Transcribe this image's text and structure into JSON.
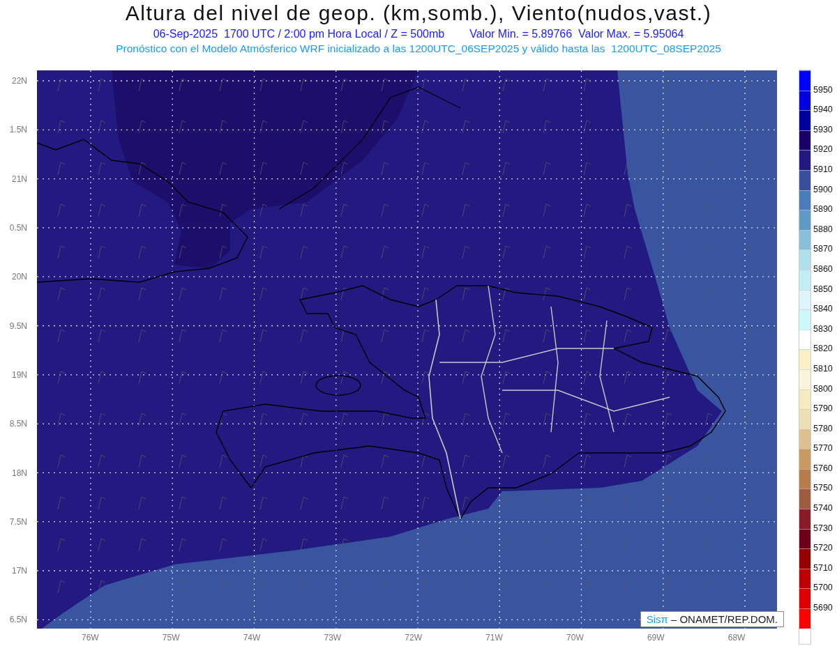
{
  "title": "Altura del nivel de geop. (km,somb.), Viento(nudos,vast.)",
  "subtitle": {
    "time": "06-Sep-2025  1700 UTC / 2:00 pm Hora Local / Z = 500mb",
    "range": "Valor Min. = 5.89766  Valor Max. = 5.95064"
  },
  "forecast_note": "Pronóstico con el Modelo Atmósferico WRF inicializado a las 1200UTC_06SEP2025 y válido hasta las  1200UTC_08SEP2025",
  "map": {
    "y_axis_labels": [
      "22N",
      "1.5N",
      "21N",
      "0.5N",
      "20N",
      "9.5N",
      "19N",
      "8.5N",
      "18N",
      "7.5N",
      "17N",
      "6.5N"
    ],
    "x_axis_labels": [
      "76W",
      "75W",
      "74W",
      "73W",
      "72W",
      "71W",
      "70W",
      "69W",
      "68W"
    ],
    "credit": {
      "logo": "Sisπ",
      "text": "– ONAMET/REP.DOM."
    }
  },
  "colorbar": {
    "bins": [
      {
        "color": "#0000ff"
      },
      {
        "color": "#0000e0"
      },
      {
        "color": "#00009a"
      },
      {
        "color": "#1a0066"
      },
      {
        "color": "#221a80"
      },
      {
        "color": "#3a4f9c"
      },
      {
        "color": "#4a7bbb"
      },
      {
        "color": "#5e99c8"
      },
      {
        "color": "#88c0dc"
      },
      {
        "color": "#b0e0ec"
      },
      {
        "color": "#c4ecf4"
      },
      {
        "color": "#ddf4fa"
      },
      {
        "color": "#ccf8fc"
      },
      {
        "color": "#ffffff"
      },
      {
        "color": "#f8f0c8"
      },
      {
        "color": "#fbf4dc"
      },
      {
        "color": "#f6eac2"
      },
      {
        "color": "#eee0b4"
      },
      {
        "color": "#dcc090"
      },
      {
        "color": "#c89a60"
      },
      {
        "color": "#b87c4c"
      },
      {
        "color": "#a05a40"
      },
      {
        "color": "#881c28"
      },
      {
        "color": "#6c0018"
      },
      {
        "color": "#940000"
      },
      {
        "color": "#bc0000"
      },
      {
        "color": "#dc0000"
      },
      {
        "color": "#ff0000"
      }
    ],
    "labels": [
      "5950",
      "5940",
      "5930",
      "5920",
      "5910",
      "5900",
      "5890",
      "5880",
      "5870",
      "5860",
      "5850",
      "5840",
      "5830",
      "5820",
      "5810",
      "5800",
      "5790",
      "5780",
      "5770",
      "5760",
      "5750",
      "5740",
      "5730",
      "5720",
      "5710",
      "5700",
      "5690"
    ]
  }
}
